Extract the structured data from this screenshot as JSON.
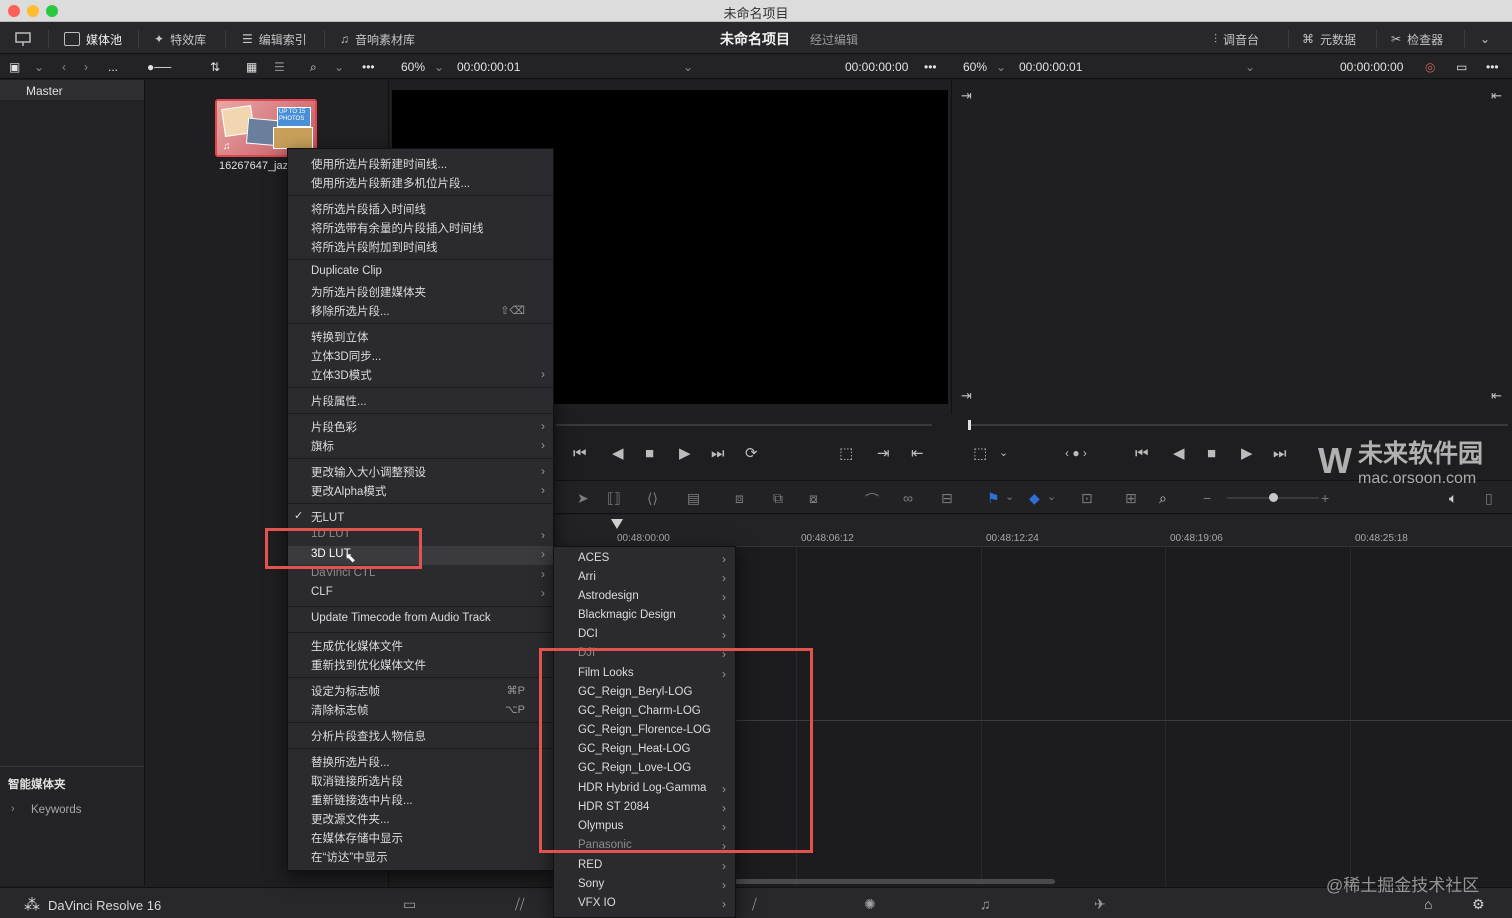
{
  "window": {
    "title": "未命名项目",
    "traffic_lights": [
      "#fe5f57",
      "#febc2e",
      "#28c840"
    ]
  },
  "toolbar": {
    "media_pool": "媒体池",
    "effects": "特效库",
    "edit_index": "编辑索引",
    "sound_library": "音响素材库",
    "project_title": "未命名项目",
    "project_status": "经过编辑",
    "mixer": "调音台",
    "metadata": "元数据",
    "inspector": "检查器"
  },
  "toolbar2": {
    "ellipsis": "...",
    "left_zoom": "60%",
    "left_timecode": "00:00:00:01",
    "left_timecode_end": "00:00:00:00",
    "right_zoom": "60%",
    "right_timecode": "00:00:00:01",
    "right_timecode_end": "00:00:00:00"
  },
  "left_panel": {
    "master": "Master",
    "smart_bins": "智能媒体夹",
    "keywords": "Keywords"
  },
  "media_pool": {
    "clip_name": "16267647_jaz",
    "thumb_badge": "UP TO 15 PHOTOS"
  },
  "timeline": {
    "timecodes": [
      "00:48:00:00",
      "00:48:06:12",
      "00:48:12:24",
      "00:48:19:06",
      "00:48:25:18"
    ]
  },
  "context_menu": {
    "items": [
      "使用所选片段新建时间线...",
      "使用所选片段新建多机位片段...",
      "将所选片段插入时间线",
      "将所选带有余量的片段插入时间线",
      "将所选片段附加到时间线",
      "Duplicate Clip",
      "为所选片段创建媒体夹",
      "移除所选片段...",
      "转换到立体",
      "立体3D同步...",
      "立体3D模式",
      "片段属性...",
      "片段色彩",
      "旗标",
      "更改输入大小调整预设",
      "更改Alpha模式",
      "无LUT",
      "1D LUT",
      "3D LUT",
      "DaVinci CTL",
      "CLF",
      "Update Timecode from Audio Track",
      "生成优化媒体文件",
      "重新找到优化媒体文件",
      "设定为标志帧",
      "清除标志帧",
      "分析片段查找人物信息",
      "替换所选片段...",
      "取消链接所选片段",
      "重新链接选中片段...",
      "更改源文件夹...",
      "在媒体存储中显示",
      "在“访达”中显示"
    ],
    "shortcuts": {
      "remove": "⇧⌫",
      "set_poster": "⌘P",
      "clear_poster": "⌥P"
    },
    "checkmark": "✓"
  },
  "submenu": {
    "items": [
      "ACES",
      "Arri",
      "Astrodesign",
      "Blackmagic Design",
      "DCI",
      "DJI",
      "Film Looks",
      "GC_Reign_Beryl-LOG",
      "GC_Reign_Charm-LOG",
      "GC_Reign_Florence-LOG",
      "GC_Reign_Heat-LOG",
      "GC_Reign_Love-LOG",
      "HDR Hybrid Log-Gamma",
      "HDR ST 2084",
      "Olympus",
      "Panasonic",
      "RED",
      "Sony",
      "VFX IO"
    ]
  },
  "bottom": {
    "app_name": "DaVinci Resolve 16"
  },
  "watermark": {
    "brand": "未来软件园",
    "domain": "mac.orsoon.com",
    "credit": "@稀土掘金技术社区"
  },
  "colors": {
    "accent_red": "#e2534d",
    "clip_border": "#e0464c",
    "flag_blue": "#2f6fd6"
  }
}
